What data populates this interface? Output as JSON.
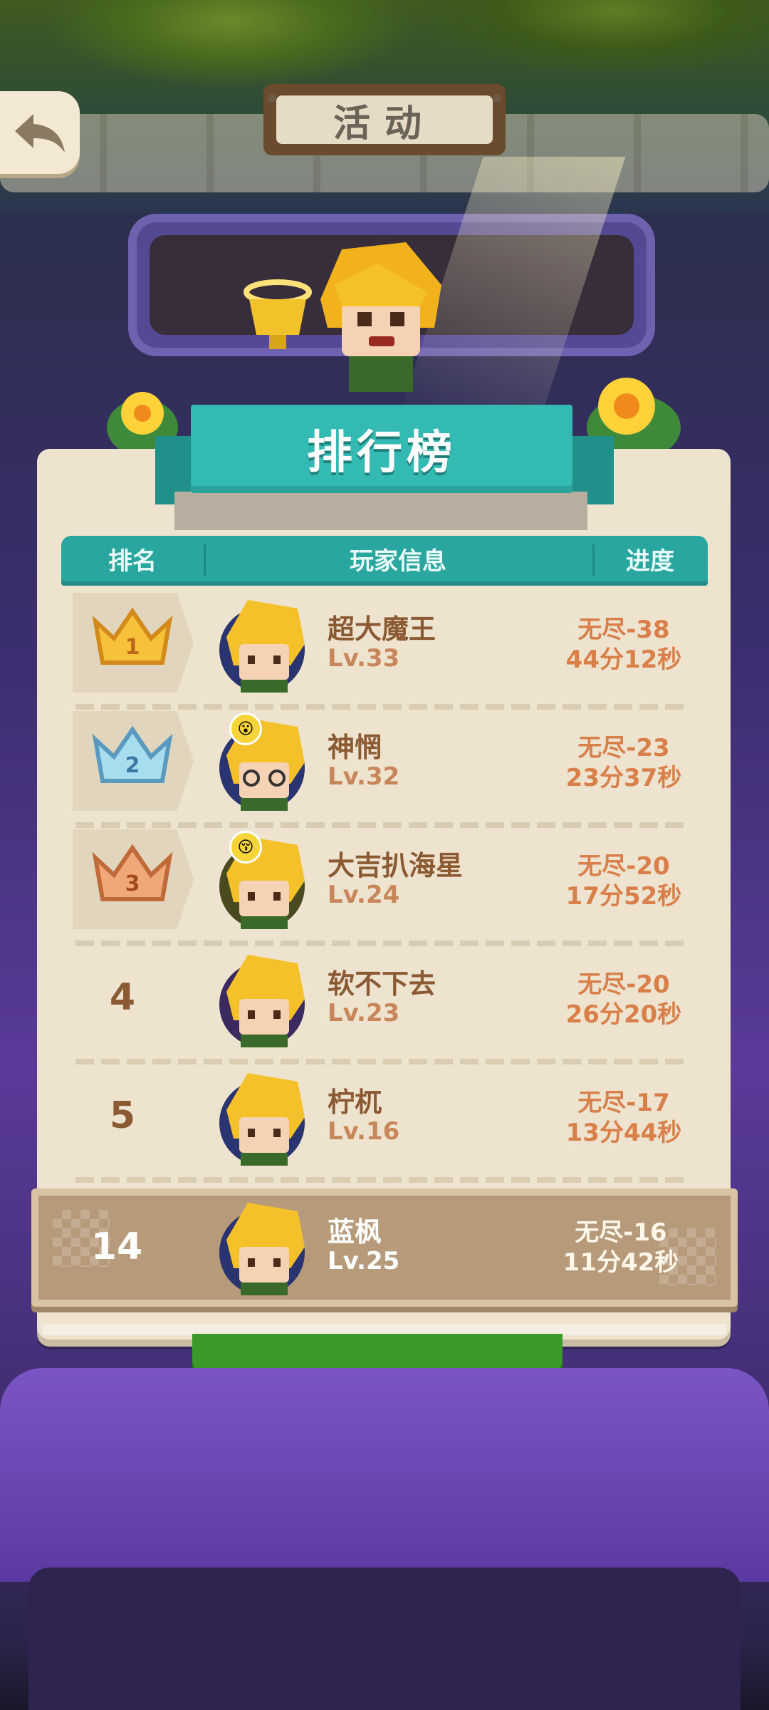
{
  "header": {
    "title": "活动",
    "back_icon": "back-arrow-icon"
  },
  "leaderboard": {
    "title": "排行榜",
    "columns": {
      "rank": "排名",
      "player": "玩家信息",
      "progress": "进度"
    },
    "rows": [
      {
        "rank": 1,
        "rank_display": "",
        "badge": "gold-crown-icon",
        "name": "超大魔王",
        "level": "Lv.33",
        "progress_stage": "无尽-38",
        "progress_time": "44分12秒"
      },
      {
        "rank": 2,
        "rank_display": "",
        "badge": "silver-crown-icon",
        "name": "神惘",
        "level": "Lv.32",
        "progress_stage": "无尽-23",
        "progress_time": "23分37秒"
      },
      {
        "rank": 3,
        "rank_display": "",
        "badge": "bronze-crown-icon",
        "name": "大吉扒海星",
        "level": "Lv.24",
        "progress_stage": "无尽-20",
        "progress_time": "17分52秒"
      },
      {
        "rank": 4,
        "rank_display": "4",
        "name": "软不下去",
        "level": "Lv.23",
        "progress_stage": "无尽-20",
        "progress_time": "26分20秒"
      },
      {
        "rank": 5,
        "rank_display": "5",
        "name": "柠杌",
        "level": "Lv.16",
        "progress_stage": "无尽-17",
        "progress_time": "13分44秒"
      }
    ],
    "self": {
      "rank_display": "14",
      "name": "蓝枫",
      "level": "Lv.25",
      "progress_stage": "无尽-16",
      "progress_time": "11分42秒"
    }
  },
  "colors": {
    "ribbon": "#33bab2",
    "header": "#2aa6a0",
    "panel": "#ede3cf",
    "accent_text": "#8b5a33",
    "progress_text": "#d9804a"
  }
}
